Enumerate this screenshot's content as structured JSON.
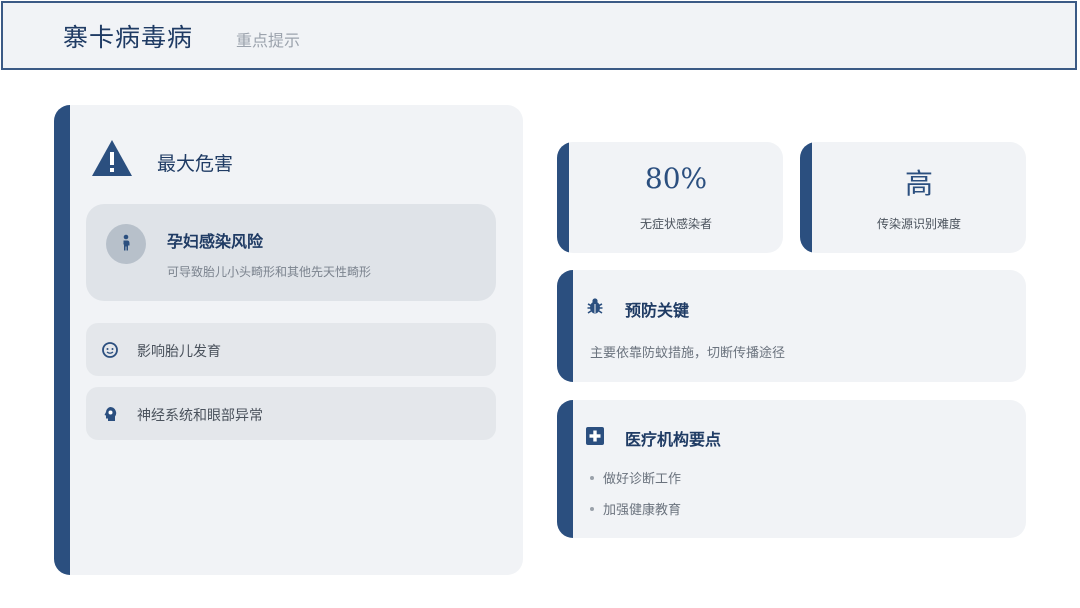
{
  "header": {
    "title": "寨卡病毒病",
    "subtitle": "重点提示"
  },
  "left_card": {
    "heading": "最大危害",
    "heading_icon": "warning-triangle-icon",
    "risk": {
      "title": "孕妇感染风险",
      "description": "可导致胎儿小头畸形和其他先天性畸形",
      "icon": "pregnant-person-icon"
    },
    "items": [
      {
        "label": "影响胎儿发育",
        "icon": "baby-face-icon"
      },
      {
        "label": "神经系统和眼部异常",
        "icon": "brain-head-icon"
      }
    ]
  },
  "stats": [
    {
      "value": "80%",
      "label": "无症状感染者"
    },
    {
      "value": "高",
      "label": "传染源识别难度"
    }
  ],
  "prevention": {
    "title": "预防关键",
    "icon": "bug-icon",
    "text": "主要依靠防蚊措施，切断传播途径"
  },
  "hospital": {
    "title": "医疗机构要点",
    "icon": "medical-cross-icon",
    "bullets": [
      "做好诊断工作",
      "加强健康教育"
    ]
  },
  "colors": {
    "accent": "#2b4f7f",
    "card_bg": "#f1f3f6",
    "header_border": "#3b5a85"
  }
}
